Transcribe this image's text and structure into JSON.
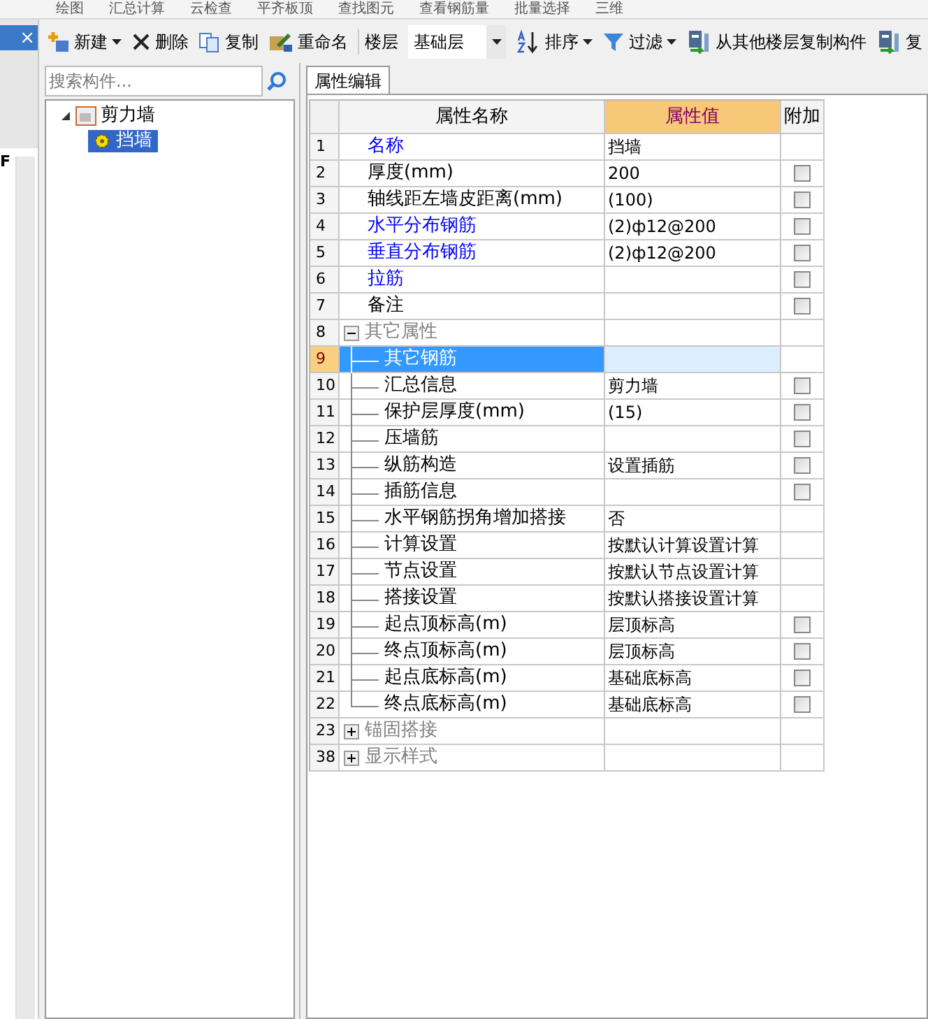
{
  "top_strip": [
    "绘图",
    "汇总计算",
    "云检查",
    "平齐板顶",
    "查找图元",
    "查看钢筋量",
    "批量选择",
    "三维"
  ],
  "toolbar": [
    {
      "label": "新建",
      "dropdown": true
    },
    {
      "label": "删除",
      "dropdown": false
    },
    {
      "label": "复制",
      "dropdown": false
    },
    {
      "label": "重命名",
      "dropdown": false
    }
  ],
  "floor": {
    "label": "楼层",
    "value": "基础层"
  },
  "toolbar2": [
    {
      "label": "排序",
      "dropdown": true
    },
    {
      "label": "过滤",
      "dropdown": true
    },
    {
      "label": "从其他楼层复制构件",
      "dropdown": false
    },
    {
      "label": "复",
      "dropdown": false
    }
  ],
  "left_strip": {
    "close": "×",
    "letter": "F"
  },
  "search": {
    "placeholder": "搜索构件..."
  },
  "tree": [
    {
      "label": "剪力墙",
      "expanded": true,
      "children": [
        {
          "label": "挡墙",
          "selected": true
        }
      ]
    }
  ],
  "tabs": [
    {
      "label": "属性编辑",
      "selected": true
    }
  ],
  "table": {
    "columns": [
      "属性名称",
      "属性值",
      "附加"
    ],
    "rows": [
      {
        "number": "1",
        "kind": "link",
        "name": "名称",
        "value": "挡墙",
        "selected": false
      },
      {
        "number": "2",
        "kind": "plain",
        "name": "厚度(mm)",
        "value": "200",
        "checkbox": {
          "checked": false
        },
        "selected": false
      },
      {
        "number": "3",
        "kind": "plain",
        "name": "轴线距左墙皮距离(mm)",
        "value": "(100)",
        "checkbox": {
          "checked": false
        },
        "selected": false
      },
      {
        "number": "4",
        "kind": "link",
        "name": "水平分布钢筋",
        "value": "(2)ф12@200",
        "checkbox": {
          "checked": false
        },
        "selected": false
      },
      {
        "number": "5",
        "kind": "link",
        "name": "垂直分布钢筋",
        "value": "(2)ф12@200",
        "checkbox": {
          "checked": false
        },
        "selected": false
      },
      {
        "number": "6",
        "kind": "link",
        "name": "拉筋",
        "checkbox": {
          "checked": false
        },
        "selected": false
      },
      {
        "number": "7",
        "kind": "plain",
        "name": "备注",
        "checkbox": {
          "checked": false
        },
        "selected": false
      },
      {
        "number": "8",
        "kind": "group",
        "name": "其它属性",
        "expanded": true,
        "selected": false
      },
      {
        "number": "9",
        "kind": "child",
        "name": "其它钢筋",
        "selected": true
      },
      {
        "number": "10",
        "kind": "child",
        "name": "汇总信息",
        "value": "剪力墙",
        "checkbox": {
          "checked": false
        },
        "selected": false
      },
      {
        "number": "11",
        "kind": "child",
        "name": "保护层厚度(mm)",
        "value": "(15)",
        "checkbox": {
          "checked": false
        },
        "selected": false
      },
      {
        "number": "12",
        "kind": "child",
        "name": "压墙筋",
        "checkbox": {
          "checked": false
        },
        "selected": false
      },
      {
        "number": "13",
        "kind": "child",
        "name": "纵筋构造",
        "value": "设置插筋",
        "checkbox": {
          "checked": false
        },
        "selected": false
      },
      {
        "number": "14",
        "kind": "child",
        "name": "插筋信息",
        "checkbox": {
          "checked": false
        },
        "selected": false
      },
      {
        "number": "15",
        "kind": "child",
        "name": "水平钢筋拐角增加搭接",
        "value": "否",
        "selected": false
      },
      {
        "number": "16",
        "kind": "child",
        "name": "计算设置",
        "value": "按默认计算设置计算",
        "selected": false
      },
      {
        "number": "17",
        "kind": "child",
        "name": "节点设置",
        "value": "按默认节点设置计算",
        "selected": false
      },
      {
        "number": "18",
        "kind": "child",
        "name": "搭接设置",
        "value": "按默认搭接设置计算",
        "selected": false
      },
      {
        "number": "19",
        "kind": "child",
        "name": "起点顶标高(m)",
        "value": "层顶标高",
        "checkbox": {
          "checked": false
        },
        "selected": false
      },
      {
        "number": "20",
        "kind": "child",
        "name": "终点顶标高(m)",
        "value": "层顶标高",
        "checkbox": {
          "checked": false
        },
        "selected": false
      },
      {
        "number": "21",
        "kind": "child",
        "name": "起点底标高(m)",
        "value": "基础底标高",
        "checkbox": {
          "checked": false
        },
        "selected": false
      },
      {
        "number": "22",
        "kind": "child",
        "name": "终点底标高(m)",
        "value": "基础底标高",
        "checkbox": {
          "checked": false
        },
        "selected": false
      },
      {
        "number": "23",
        "kind": "group",
        "name": "锚固搭接",
        "expanded": false,
        "selected": false
      },
      {
        "number": "38",
        "kind": "group",
        "name": "显示样式",
        "expanded": false,
        "selected": false
      }
    ]
  }
}
